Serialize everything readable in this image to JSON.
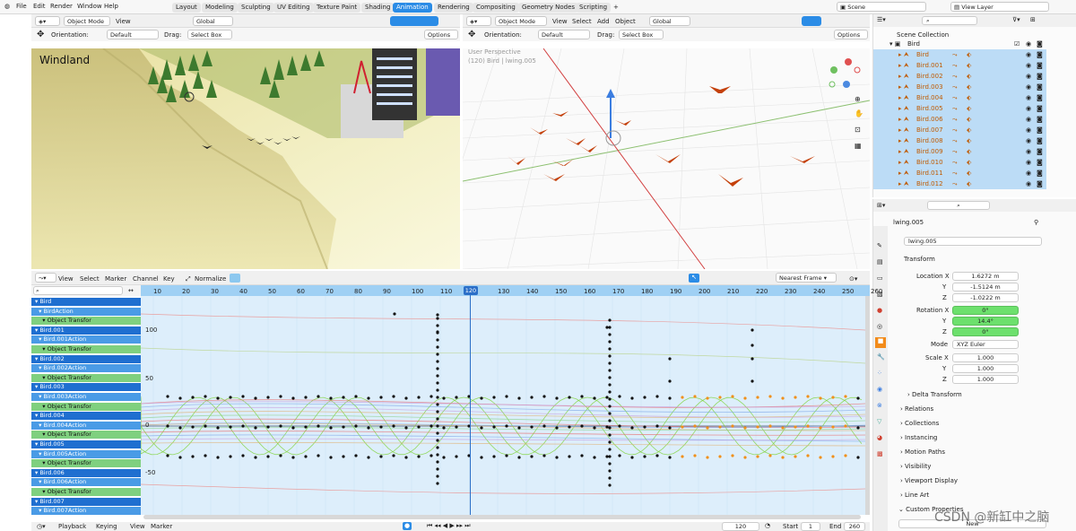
{
  "menubar": {
    "items": [
      "File",
      "Edit",
      "Render",
      "Window",
      "Help"
    ]
  },
  "workspaces": {
    "tabs": [
      "Layout",
      "Modeling",
      "Sculpting",
      "UV Editing",
      "Texture Paint",
      "Shading",
      "Animation",
      "Rendering",
      "Compositing",
      "Geometry Nodes",
      "Scripting"
    ],
    "active": "Animation",
    "add": "+"
  },
  "scene": {
    "name": "Scene",
    "view_layer": "View Layer"
  },
  "viewport_left": {
    "mode": "Object Mode",
    "view": "View",
    "transform": "Global",
    "orientation_label": "Orientation:",
    "orientation": "Default",
    "drag_label": "Drag:",
    "drag": "Select Box",
    "options": "Options",
    "overlay_text": "Windland"
  },
  "viewport_right": {
    "mode": "Object Mode",
    "menus": [
      "View",
      "Select",
      "Add",
      "Object"
    ],
    "transform": "Global",
    "orientation_label": "Orientation:",
    "orientation": "Default",
    "drag_label": "Drag:",
    "drag": "Select Box",
    "options": "Options",
    "perspective": "User Perspective",
    "info": "(120) Bird | lwing.005"
  },
  "outliner": {
    "search": "",
    "collection": "Scene Collection",
    "root": "Bird",
    "items": [
      "Bird",
      "Bird.001",
      "Bird.002",
      "Bird.003",
      "Bird.004",
      "Bird.005",
      "Bird.006",
      "Bird.007",
      "Bird.008",
      "Bird.009",
      "Bird.010",
      "Bird.011",
      "Bird.012"
    ]
  },
  "properties": {
    "object_name": "lwing.005",
    "data_name": "lwing.005",
    "transform_title": "Transform",
    "location": {
      "label": "Location X",
      "x": "1.6272 m",
      "y": "-1.5124 m",
      "z": "-1.0222 m"
    },
    "rotation": {
      "label": "Rotation X",
      "x": "0°",
      "y": "14.4°",
      "z": "0°"
    },
    "mode_label": "Mode",
    "mode": "XYZ Euler",
    "scale": {
      "label": "Scale X",
      "x": "1.000",
      "y": "1.000",
      "z": "1.000"
    },
    "axis_y": "Y",
    "axis_z": "Z",
    "sections": [
      "Delta Transform",
      "Relations",
      "Collections",
      "Instancing",
      "Motion Paths",
      "Visibility",
      "Viewport Display",
      "Line Art",
      "Custom Properties"
    ],
    "new_button": "New"
  },
  "graph_editor": {
    "menus": [
      "View",
      "Select",
      "Marker",
      "Channel",
      "Key"
    ],
    "normalize": "Normalize",
    "snap": "Nearest Frame",
    "frames": [
      "10",
      "20",
      "30",
      "40",
      "50",
      "60",
      "70",
      "80",
      "90",
      "100",
      "110",
      "120",
      "130",
      "140",
      "150",
      "160",
      "170",
      "180",
      "190",
      "200",
      "210",
      "220",
      "230",
      "240",
      "250",
      "260"
    ],
    "current_frame": "120",
    "y_labels": [
      "100",
      "50",
      "0",
      "-50"
    ],
    "channels": [
      {
        "type": "obj",
        "label": "Bird"
      },
      {
        "type": "act",
        "label": "BirdAction"
      },
      {
        "type": "tr",
        "label": "Object Transfor"
      },
      {
        "type": "obj",
        "label": "Bird.001"
      },
      {
        "type": "act",
        "label": "Bird.001Action"
      },
      {
        "type": "tr",
        "label": "Object Transfor"
      },
      {
        "type": "obj",
        "label": "Bird.002"
      },
      {
        "type": "act",
        "label": "Bird.002Action"
      },
      {
        "type": "tr",
        "label": "Object Transfor"
      },
      {
        "type": "obj",
        "label": "Bird.003"
      },
      {
        "type": "act",
        "label": "Bird.003Action"
      },
      {
        "type": "tr",
        "label": "Object Transfor"
      },
      {
        "type": "obj",
        "label": "Bird.004"
      },
      {
        "type": "act",
        "label": "Bird.004Action"
      },
      {
        "type": "tr",
        "label": "Object Transfor"
      },
      {
        "type": "obj",
        "label": "Bird.005"
      },
      {
        "type": "act",
        "label": "Bird.005Action"
      },
      {
        "type": "tr",
        "label": "Object Transfor"
      },
      {
        "type": "obj",
        "label": "Bird.006"
      },
      {
        "type": "act",
        "label": "Bird.006Action"
      },
      {
        "type": "tr",
        "label": "Object Transfor"
      },
      {
        "type": "obj",
        "label": "Bird.007"
      },
      {
        "type": "act",
        "label": "Bird.007Action"
      }
    ]
  },
  "timeline": {
    "menus": [
      "Playback",
      "Keying",
      "View",
      "Marker"
    ],
    "frame": "120",
    "start_label": "Start",
    "start": "1",
    "end_label": "End",
    "end": "260"
  },
  "watermark": "CSDN @新缸中之脑"
}
